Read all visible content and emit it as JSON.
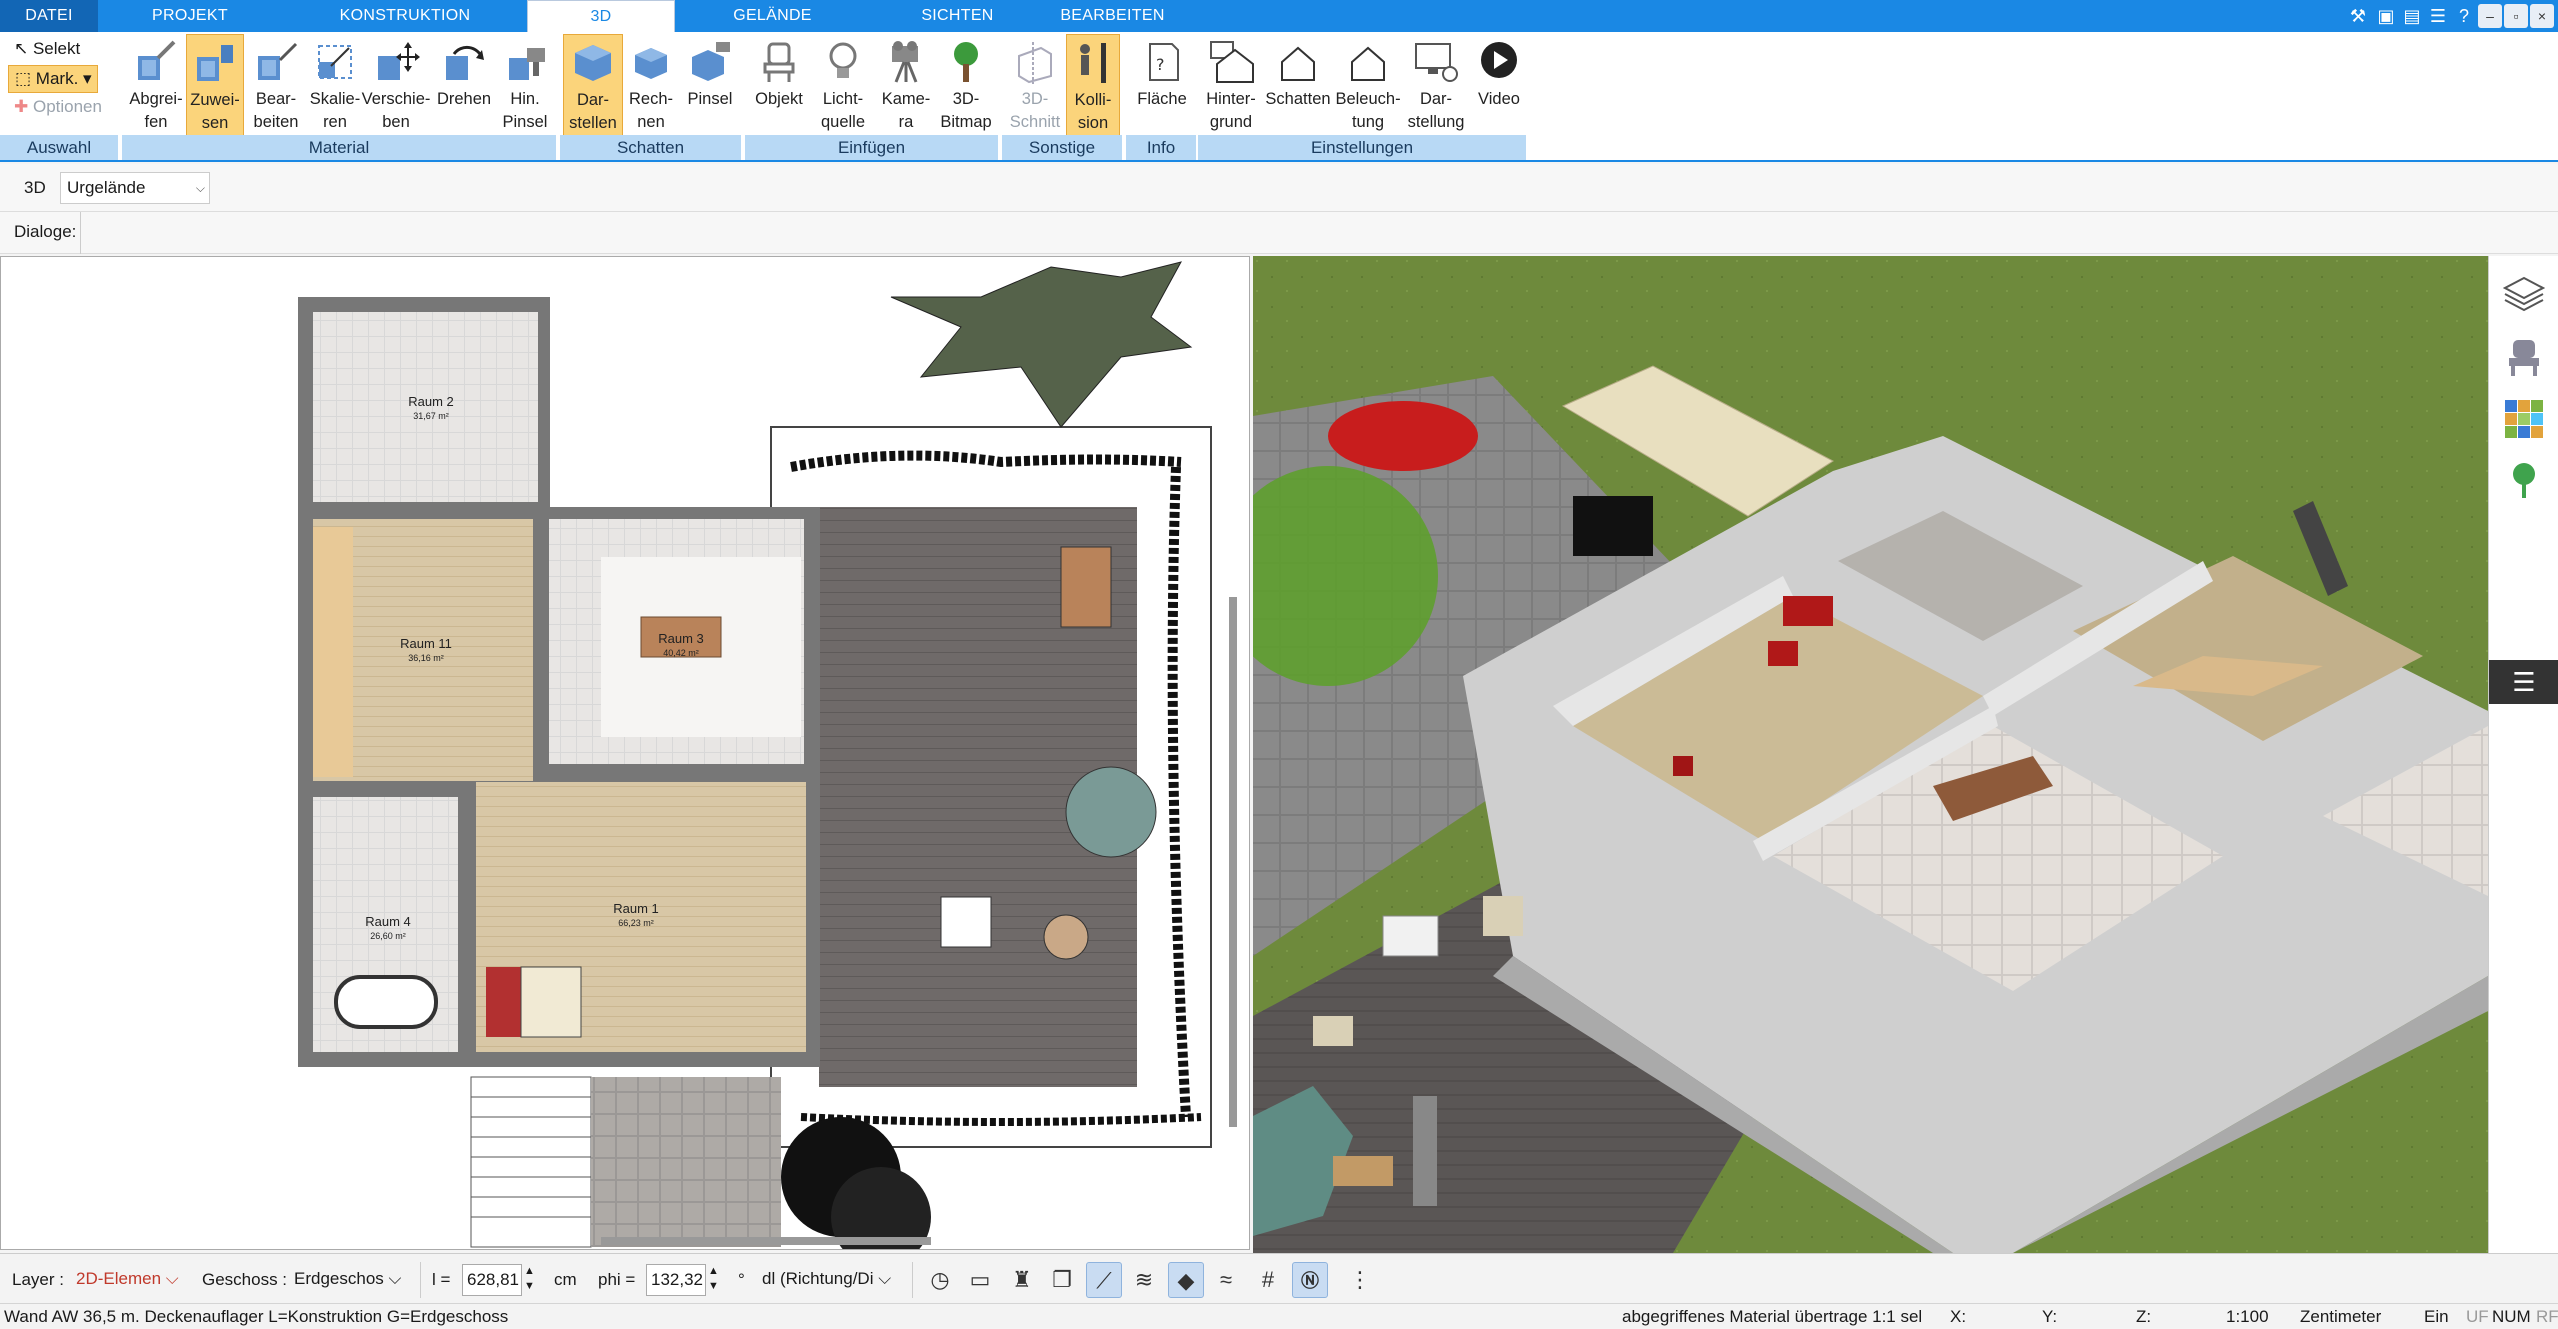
{
  "tabs": [
    "DATEI",
    "PROJEKT",
    "KONSTRUKTION",
    "3D",
    "GELÄNDE",
    "SICHTEN",
    "BEARBEITEN"
  ],
  "active_tab": "3D",
  "window_controls": {
    "minimize": "–",
    "restore": "▫",
    "close": "×",
    "help": "?"
  },
  "ribbon": {
    "selection": {
      "select": "Selekt",
      "mark": "Mark.",
      "options": "Optionen",
      "group": "Auswahl"
    },
    "material": {
      "buttons": [
        "Abgrei-\nfen",
        "Zuwei-\nsen",
        "Bear-\nbeiten",
        "Skalie-\nren",
        "Verschie-\nben",
        "Drehen",
        "Hin.\nPinsel"
      ],
      "group": "Material"
    },
    "shadow": {
      "buttons": [
        "Dar-\nstellen",
        "Rech-\nnen",
        "Pinsel"
      ],
      "group": "Schatten"
    },
    "insert": {
      "buttons": [
        "Objekt",
        "Licht-\nquelle",
        "Kame-\nra",
        "3D-\nBitmap"
      ],
      "group": "Einfügen"
    },
    "misc": {
      "buttons": [
        "3D-\nSchnitt",
        "Kolli-\nsion"
      ],
      "group": "Sonstige"
    },
    "info": {
      "buttons": [
        "Fläche"
      ],
      "group": "Info"
    },
    "settings": {
      "buttons": [
        "Hinter-\ngrund",
        "Schatten",
        "Beleuch-\ntung",
        "Dar-\nstellung",
        "Video"
      ],
      "group": "Einstellungen"
    }
  },
  "view_selector": {
    "label": "3D",
    "value": "Urgelände"
  },
  "dialog_bar": {
    "label": "Dialoge:"
  },
  "rooms": [
    {
      "name": "Raum 2",
      "area": "31,67 m²"
    },
    {
      "name": "Raum 11",
      "area": "36,16 m²"
    },
    {
      "name": "Raum 3",
      "area": "40,42 m²"
    },
    {
      "name": "Raum 4",
      "area": "26,60 m²"
    },
    {
      "name": "Raum 1",
      "area": "66,23 m²"
    }
  ],
  "options_bar": {
    "layer_label": "Layer :",
    "layer_value": "2D-Elemen",
    "floor_label": "Geschoss :",
    "floor_value": "Erdgeschos",
    "l_label": "l =",
    "l_value": "628,81",
    "l_unit": "cm",
    "phi_label": "phi =",
    "phi_value": "132,32",
    "phi_unit": "°",
    "dl_value": "dl (Richtung/Di"
  },
  "status": {
    "left": "Wand AW 36,5 m. Deckenauflager L=Konstruktion G=Erdgeschoss",
    "middle": "abgegriffenes Material übertrage 1:1 sel",
    "x": "X:",
    "y": "Y:",
    "z": "Z:",
    "scale": "1:100",
    "unit": "Zentimeter",
    "mode": "Ein",
    "uf": "UF",
    "num": "NUM",
    "rf": "RF"
  },
  "colors": {
    "accent": "#1a88e4",
    "ribbon_group": "#b8d9f5",
    "selected": "#fbd47b"
  }
}
